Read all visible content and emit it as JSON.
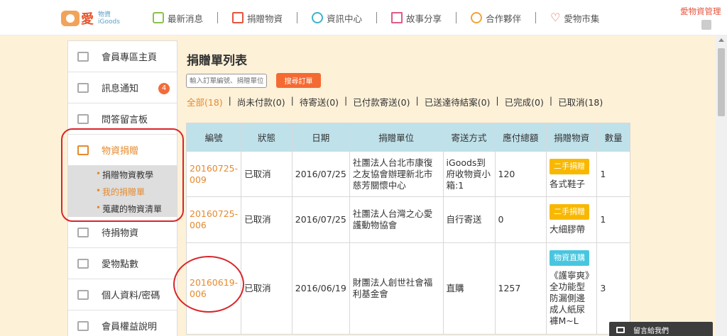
{
  "header": {
    "logo_text": "愛",
    "logo_sub_cn": "物資",
    "logo_sub_en": "iGoods",
    "nav": [
      {
        "label": "最新消息",
        "icon": "news-icon"
      },
      {
        "label": "捐贈物資",
        "icon": "gift-icon"
      },
      {
        "label": "資訊中心",
        "icon": "info-icon"
      },
      {
        "label": "故事分享",
        "icon": "book-icon"
      },
      {
        "label": "合作夥伴",
        "icon": "smile-icon"
      },
      {
        "label": "愛物市集",
        "icon": "heart-icon"
      }
    ],
    "top_right": "愛物資管理"
  },
  "sidebar": {
    "items": [
      {
        "label": "會員專區主頁",
        "icon": "monitor-icon"
      },
      {
        "label": "訊息通知",
        "icon": "message-icon",
        "badge": "4"
      },
      {
        "label": "問答留言板",
        "icon": "chat-icon"
      },
      {
        "label": "物資捐贈",
        "icon": "gift-icon"
      },
      {
        "label": "待捐物資",
        "icon": "clock-icon"
      },
      {
        "label": "愛物點數",
        "icon": "ticket-icon"
      },
      {
        "label": "個人資料/密碼",
        "icon": "user-icon"
      },
      {
        "label": "會員權益說明",
        "icon": "card-icon"
      }
    ],
    "submenu": [
      {
        "label": "捐贈物資教學"
      },
      {
        "label": "我的捐贈單"
      },
      {
        "label": "蒐藏的物資清單"
      }
    ]
  },
  "main": {
    "title": "捐贈單列表",
    "search_placeholder": "輸入訂單編號、捐贈單位",
    "search_button": "搜尋訂單",
    "filters": [
      {
        "label": "全部(18)"
      },
      {
        "label": "尚未付款(0)"
      },
      {
        "label": "待寄送(0)"
      },
      {
        "label": "已付款寄送(0)"
      },
      {
        "label": "已送達待結案(0)"
      },
      {
        "label": "已完成(0)"
      },
      {
        "label": "已取消(18)"
      }
    ],
    "table": {
      "headers": [
        "編號",
        "狀態",
        "日期",
        "捐贈單位",
        "寄送方式",
        "應付總額",
        "捐贈物資",
        "數量"
      ],
      "rows": [
        {
          "order_no": "20160725-009",
          "status": "已取消",
          "date": "2016/07/25",
          "unit": "社團法人台北市康復之友協會辦理新北市慈芳關懷中心",
          "shipping": "iGoods到府收物資小箱:1",
          "total": "120",
          "tag": "二手捐贈",
          "tag_color": "#f8b800",
          "item": "各式鞋子",
          "qty": "1"
        },
        {
          "order_no": "20160725-006",
          "status": "已取消",
          "date": "2016/07/25",
          "unit": "社團法人台灣之心愛護動物協會",
          "shipping": "自行寄送",
          "total": "0",
          "tag": "二手捐贈",
          "tag_color": "#f8b800",
          "item": "大細膠帶",
          "qty": "1"
        },
        {
          "order_no": "20160619-006",
          "status": "已取消",
          "date": "2016/06/19",
          "unit": "財團法人創世社會福利基金會",
          "shipping": "直購",
          "total": "1257",
          "tag": "物資直購",
          "tag_color": "#49c6df",
          "item": "《護寧爽》全功能型防漏側邊成人紙尿褲M~L",
          "qty": "3"
        }
      ]
    }
  },
  "chat": {
    "label": "留言給我們"
  }
}
